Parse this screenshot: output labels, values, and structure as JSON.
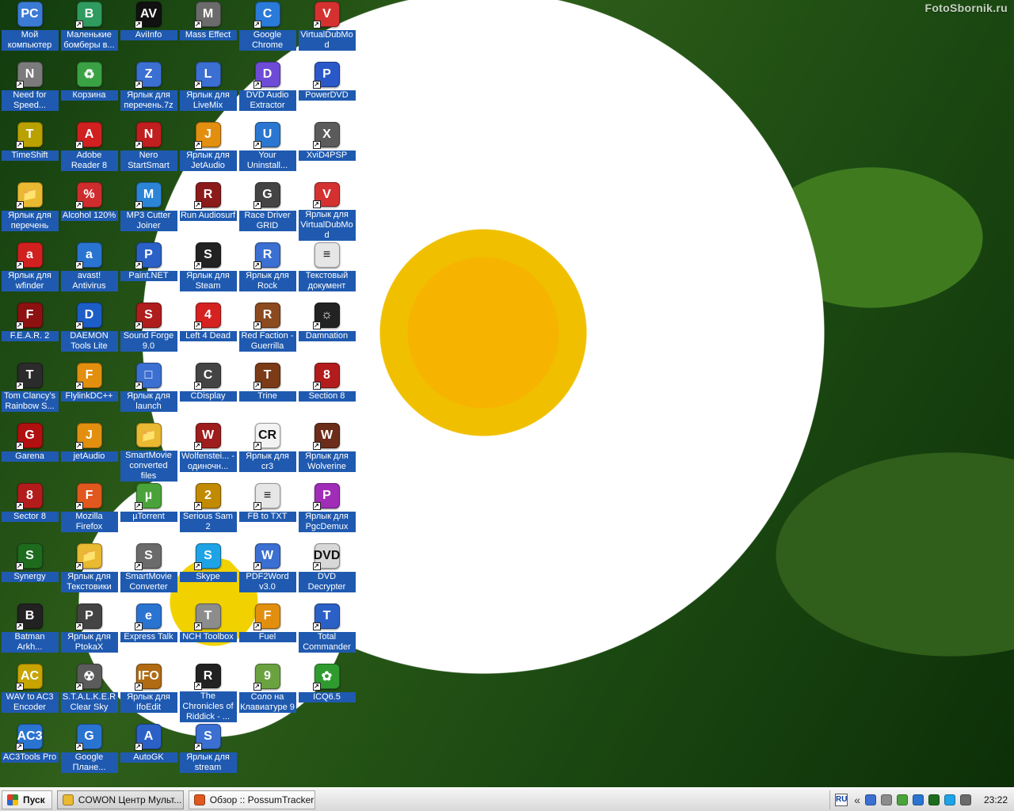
{
  "desktop": {
    "watermark": "FotoSbornik.ru"
  },
  "icons": [
    {
      "label": "Мой компьютер",
      "glyph": "PC",
      "color": "#3b7bd6",
      "shortcut": false
    },
    {
      "label": "Маленькие бомберы в...",
      "glyph": "B",
      "color": "#2f9b5e",
      "shortcut": true
    },
    {
      "label": "AviInfo",
      "glyph": "AV",
      "color": "#111111",
      "shortcut": true
    },
    {
      "label": "Mass Effect",
      "glyph": "M",
      "color": "#6b6b6b",
      "shortcut": true
    },
    {
      "label": "Google Chrome",
      "glyph": "C",
      "color": "#2a7ad9",
      "shortcut": true
    },
    {
      "label": "VirtualDubMod",
      "glyph": "V",
      "color": "#d53131",
      "shortcut": true
    },
    {
      "label": "Need for Speed...",
      "glyph": "N",
      "color": "#7b7b7b",
      "shortcut": true
    },
    {
      "label": "Корзина",
      "glyph": "♻",
      "color": "#3aa245",
      "shortcut": false
    },
    {
      "label": "Ярлык для перечень.7z",
      "glyph": "Z",
      "color": "#3b6fd1",
      "shortcut": true
    },
    {
      "label": "Ярлык для LiveMix",
      "glyph": "L",
      "color": "#3b6fd1",
      "shortcut": true
    },
    {
      "label": "DVD Audio Extractor",
      "glyph": "D",
      "color": "#6d4bd6",
      "shortcut": true
    },
    {
      "label": "PowerDVD",
      "glyph": "P",
      "color": "#2a58c9",
      "shortcut": true
    },
    {
      "label": "TimeShift",
      "glyph": "T",
      "color": "#b9a100",
      "shortcut": true
    },
    {
      "label": "Adobe Reader 8",
      "glyph": "A",
      "color": "#d12020",
      "shortcut": true
    },
    {
      "label": "Nero StartSmart",
      "glyph": "N",
      "color": "#c11f1f",
      "shortcut": true
    },
    {
      "label": "Ярлык для JetAudio",
      "glyph": "J",
      "color": "#e28f10",
      "shortcut": true
    },
    {
      "label": "Your Uninstall...",
      "glyph": "U",
      "color": "#2a77d1",
      "shortcut": true
    },
    {
      "label": "XviD4PSP",
      "glyph": "X",
      "color": "#5b5b5b",
      "shortcut": true
    },
    {
      "label": "Ярлык для перечень",
      "glyph": "📁",
      "color": "#e8b931",
      "shortcut": true
    },
    {
      "label": "Alcohol 120%",
      "glyph": "%",
      "color": "#cf2d2d",
      "shortcut": true
    },
    {
      "label": "MP3 Cutter Joiner",
      "glyph": "M",
      "color": "#2b84d6",
      "shortcut": true
    },
    {
      "label": "Run Audiosurf",
      "glyph": "R",
      "color": "#8b1b1b",
      "shortcut": true
    },
    {
      "label": "Race Driver GRID",
      "glyph": "G",
      "color": "#444444",
      "shortcut": true
    },
    {
      "label": "Ярлык для VirtualDubMod",
      "glyph": "V",
      "color": "#d53131",
      "shortcut": true
    },
    {
      "label": "Ярлык для wfinder",
      "glyph": "a",
      "color": "#d12020",
      "shortcut": true
    },
    {
      "label": "avast! Antivirus",
      "glyph": "a",
      "color": "#2a74d1",
      "shortcut": true
    },
    {
      "label": "Paint.NET",
      "glyph": "P",
      "color": "#2b61c7",
      "shortcut": true
    },
    {
      "label": "Ярлык для Steam",
      "glyph": "S",
      "color": "#222222",
      "shortcut": true
    },
    {
      "label": "Ярлык для Rock",
      "glyph": "R",
      "color": "#3b6fd1",
      "shortcut": true
    },
    {
      "label": "Текстовый документ",
      "glyph": "≡",
      "color": "#e6e6e6",
      "shortcut": false
    },
    {
      "label": "F.E.A.R. 2",
      "glyph": "F",
      "color": "#8d1111",
      "shortcut": true
    },
    {
      "label": "DAEMON Tools Lite",
      "glyph": "D",
      "color": "#1c5dc8",
      "shortcut": true
    },
    {
      "label": "Sound Forge 9.0",
      "glyph": "S",
      "color": "#b01d1d",
      "shortcut": true
    },
    {
      "label": "Left 4 Dead",
      "glyph": "4",
      "color": "#d62121",
      "shortcut": true
    },
    {
      "label": "Red Faction - Guerrilla",
      "glyph": "R",
      "color": "#8b4a1f",
      "shortcut": true
    },
    {
      "label": "Damnation",
      "glyph": "☼",
      "color": "#222222",
      "shortcut": true
    },
    {
      "label": "Tom Clancy's Rainbow S...",
      "glyph": "T",
      "color": "#2b2b2b",
      "shortcut": true
    },
    {
      "label": "FlylinkDC++",
      "glyph": "F",
      "color": "#e28f10",
      "shortcut": true
    },
    {
      "label": "Ярлык для launch",
      "glyph": "□",
      "color": "#3b6fd1",
      "shortcut": true
    },
    {
      "label": "CDisplay",
      "glyph": "C",
      "color": "#444444",
      "shortcut": true
    },
    {
      "label": "Trine",
      "glyph": "T",
      "color": "#7a3b16",
      "shortcut": true
    },
    {
      "label": "Section 8",
      "glyph": "8",
      "color": "#b31c1c",
      "shortcut": true
    },
    {
      "label": "Garena",
      "glyph": "G",
      "color": "#b01010",
      "shortcut": true
    },
    {
      "label": "jetAudio",
      "glyph": "J",
      "color": "#e28f10",
      "shortcut": true
    },
    {
      "label": "SmartMovie converted files",
      "glyph": "📁",
      "color": "#e8b931",
      "shortcut": false
    },
    {
      "label": "Wolfenstei... - одиночн...",
      "glyph": "W",
      "color": "#9e1d1d",
      "shortcut": true
    },
    {
      "label": "Ярлык для cr3",
      "glyph": "CR",
      "color": "#f2f2f2",
      "shortcut": true
    },
    {
      "label": "Ярлык для Wolverine",
      "glyph": "W",
      "color": "#6b2c1a",
      "shortcut": true
    },
    {
      "label": "Sector 8",
      "glyph": "8",
      "color": "#b31c1c",
      "shortcut": true
    },
    {
      "label": "Mozilla Firefox",
      "glyph": "F",
      "color": "#e1581f",
      "shortcut": true
    },
    {
      "label": "µTorrent",
      "glyph": "µ",
      "color": "#4aa33a",
      "shortcut": true
    },
    {
      "label": "Serious Sam 2",
      "glyph": "2",
      "color": "#c18a00",
      "shortcut": true
    },
    {
      "label": "FB to TXT",
      "glyph": "≡",
      "color": "#e6e6e6",
      "shortcut": true
    },
    {
      "label": "Ярлык для PgcDemux",
      "glyph": "P",
      "color": "#a02cb7",
      "shortcut": true
    },
    {
      "label": "Synergy",
      "glyph": "S",
      "color": "#1e6b1e",
      "shortcut": true
    },
    {
      "label": "Ярлык для Текстовики",
      "glyph": "📁",
      "color": "#e8b931",
      "shortcut": true
    },
    {
      "label": "SmartMovie Converter",
      "glyph": "S",
      "color": "#6b6b6b",
      "shortcut": true
    },
    {
      "label": "Skype",
      "glyph": "S",
      "color": "#1ea3e6",
      "shortcut": true
    },
    {
      "label": "PDF2Word v3.0",
      "glyph": "W",
      "color": "#3b6fd1",
      "shortcut": true
    },
    {
      "label": "DVD Decrypter",
      "glyph": "DVD",
      "color": "#d8d8d8",
      "shortcut": true
    },
    {
      "label": "Batman Arkh...",
      "glyph": "B",
      "color": "#222222",
      "shortcut": true
    },
    {
      "label": "Ярлык для PtokaX",
      "glyph": "P",
      "color": "#444444",
      "shortcut": true
    },
    {
      "label": "Express Talk",
      "glyph": "e",
      "color": "#2a74d1",
      "shortcut": true
    },
    {
      "label": "NCH Toolbox",
      "glyph": "T",
      "color": "#8c8c8c",
      "shortcut": true
    },
    {
      "label": "Fuel",
      "glyph": "F",
      "color": "#e28f10",
      "shortcut": true
    },
    {
      "label": "Total Commander",
      "glyph": "T",
      "color": "#2b61c7",
      "shortcut": true
    },
    {
      "label": "WAV to AC3 Encoder",
      "glyph": "AC",
      "color": "#c7a400",
      "shortcut": true
    },
    {
      "label": "S.T.A.L.K.E.R Clear Sky",
      "glyph": "☢",
      "color": "#5b5b5b",
      "shortcut": true
    },
    {
      "label": "Ярлык для IfoEdit",
      "glyph": "IFO",
      "color": "#b06b13",
      "shortcut": true
    },
    {
      "label": "The Chronicles of Riddick - ...",
      "glyph": "R",
      "color": "#222222",
      "shortcut": true
    },
    {
      "label": "Соло на Клавиатуре 9",
      "glyph": "9",
      "color": "#6aa240",
      "shortcut": true
    },
    {
      "label": "ICQ6.5",
      "glyph": "✿",
      "color": "#2f9b2f",
      "shortcut": true
    },
    {
      "label": "AC3Tools Pro",
      "glyph": "AC3",
      "color": "#2a74d1",
      "shortcut": true
    },
    {
      "label": "Google Плане...",
      "glyph": "G",
      "color": "#2a74d1",
      "shortcut": true
    },
    {
      "label": "AutoGK",
      "glyph": "A",
      "color": "#2b61c7",
      "shortcut": true
    },
    {
      "label": "Ярлык для stream",
      "glyph": "S",
      "color": "#3b6fd1",
      "shortcut": true
    }
  ],
  "taskbar": {
    "start_label": "Пуск",
    "tasks": [
      {
        "label": "COWON Центр Мульт...",
        "active": true,
        "color": "#e8b931"
      },
      {
        "label": "Обзор :: PossumTracker ...",
        "active": false,
        "color": "#e1581f"
      }
    ],
    "tray": {
      "lang": "RU",
      "chevron": "«",
      "icons": [
        {
          "name": "monitor-icon",
          "color": "#3b6fd1"
        },
        {
          "name": "speaker-icon",
          "color": "#8c8c8c"
        },
        {
          "name": "utorrent-icon",
          "color": "#4aa33a"
        },
        {
          "name": "network-icon",
          "color": "#2a74d1"
        },
        {
          "name": "antivirus-icon",
          "color": "#1e6b1e"
        },
        {
          "name": "skype-icon",
          "color": "#1ea3e6"
        },
        {
          "name": "settings-icon",
          "color": "#6b6b6b"
        }
      ],
      "clock": "23:22"
    }
  }
}
